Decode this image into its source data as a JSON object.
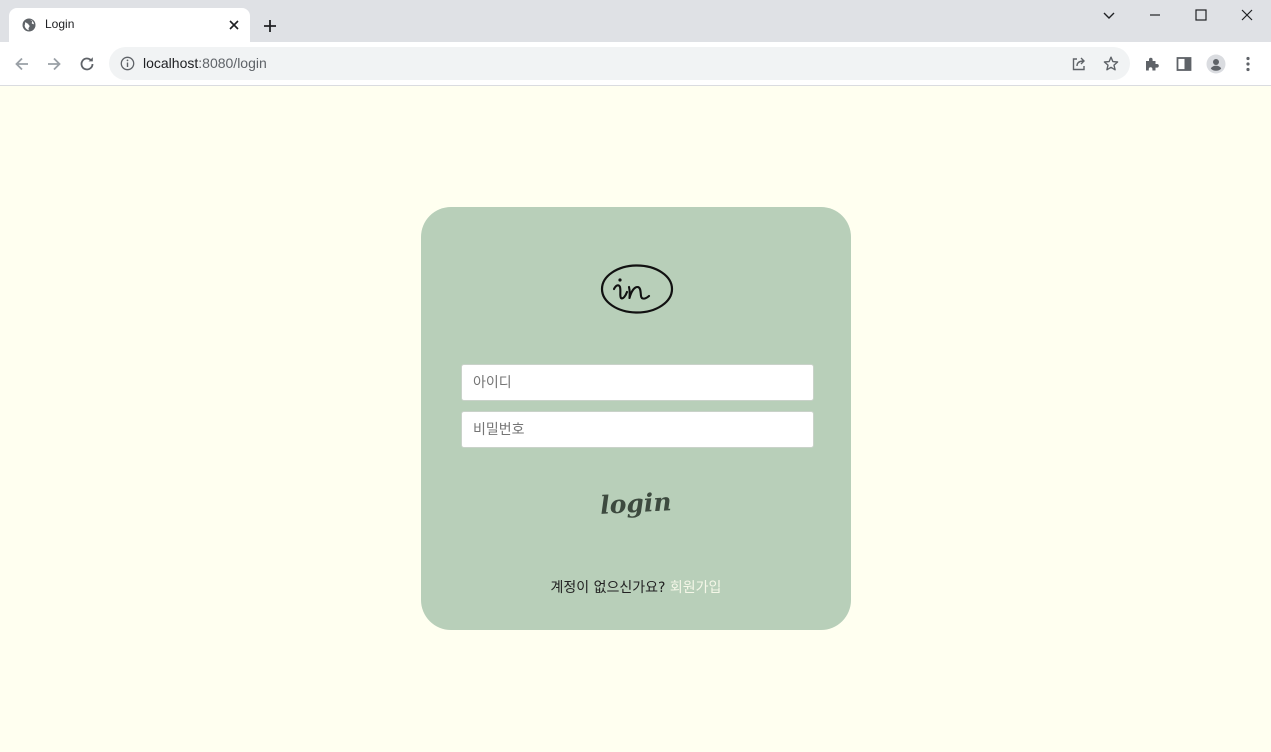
{
  "browser": {
    "tab_title": "Login",
    "url_host": "localhost",
    "url_rest": ":8080/login"
  },
  "login_form": {
    "id_placeholder": "아이디",
    "password_placeholder": "비밀번호",
    "submit_label": "login"
  },
  "signup": {
    "prompt": "계정이 없으신가요?",
    "link_label": "회원가입"
  },
  "colors": {
    "page_bg": "#fffff0",
    "card_bg": "#b8cfb9",
    "signup_link": "#f5f7e8",
    "login_text": "#3d4a3f"
  },
  "icons": [
    "globe-icon",
    "close-icon",
    "plus-icon",
    "chevron-down-icon",
    "minimize-icon",
    "maximize-icon",
    "close-window-icon",
    "back-arrow-icon",
    "forward-arrow-icon",
    "reload-icon",
    "info-icon",
    "share-icon",
    "star-icon",
    "puzzle-icon",
    "side-panel-icon",
    "profile-icon",
    "kebab-menu-icon",
    "logo-icon"
  ]
}
